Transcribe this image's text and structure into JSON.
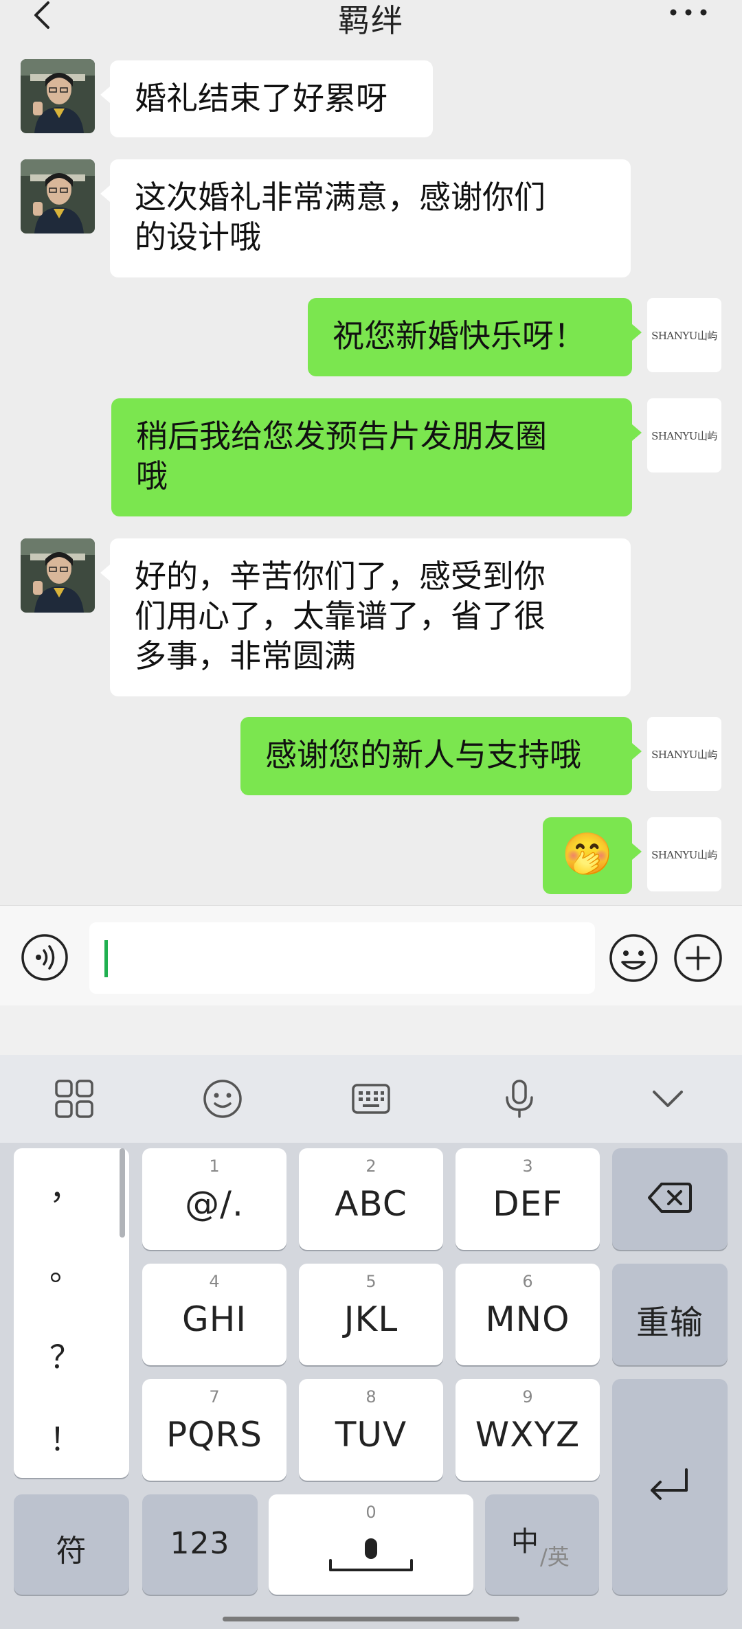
{
  "header": {
    "title": "羁绊"
  },
  "messages": [
    {
      "side": "left",
      "line1": "婚礼结束了好累呀",
      "line2": "",
      "line3": ""
    },
    {
      "side": "left",
      "line1": "这次婚礼非常满意，感谢你们",
      "line2": "的设计哦",
      "line3": ""
    },
    {
      "side": "right",
      "line1": "祝您新婚快乐呀！",
      "line2": "",
      "line3": ""
    },
    {
      "side": "right",
      "line1": "稍后我给您发预告片发朋友圈",
      "line2": "哦",
      "line3": ""
    },
    {
      "side": "left",
      "line1": "好的，辛苦你们了，感受到你",
      "line2": "们用心了，太靠谱了，省了很",
      "line3": "多事，非常圆满"
    },
    {
      "side": "right",
      "line1": "感谢您的新人与支持哦",
      "line2": "",
      "line3": ""
    },
    {
      "side": "right",
      "sticker": "🤭"
    }
  ],
  "self_avatar_text": "SHANYU山屿",
  "keyboard": {
    "punctuation": [
      "，",
      "。",
      "？",
      "！"
    ],
    "keys": [
      {
        "num": "1",
        "label": "@/."
      },
      {
        "num": "2",
        "label": "ABC"
      },
      {
        "num": "3",
        "label": "DEF"
      },
      {
        "num": "4",
        "label": "GHI"
      },
      {
        "num": "5",
        "label": "JKL"
      },
      {
        "num": "6",
        "label": "MNO"
      },
      {
        "num": "7",
        "label": "PQRS"
      },
      {
        "num": "8",
        "label": "TUV"
      },
      {
        "num": "9",
        "label": "WXYZ"
      }
    ],
    "reenter": "重输",
    "symbols": "符",
    "numbers": "123",
    "space_num": "0",
    "lang_main": "中",
    "lang_sub": "/英"
  }
}
